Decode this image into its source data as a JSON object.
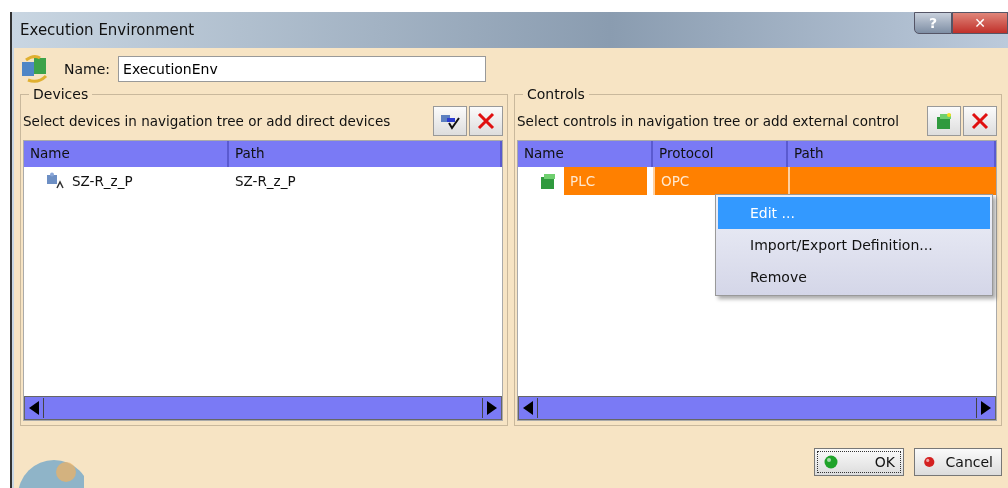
{
  "window": {
    "title": "Execution Environment",
    "help": "?",
    "close": "✕"
  },
  "name_field": {
    "label": "Name:",
    "value": "ExecutionEnv"
  },
  "devices": {
    "title": "Devices",
    "hint": "Select devices in navigation tree or add direct devices",
    "columns": [
      "Name",
      "Path"
    ],
    "rows": [
      {
        "name": "SZ-R_z_P",
        "path": "SZ-R_z_P",
        "selected": false
      }
    ]
  },
  "controls": {
    "title": "Controls",
    "hint": "Select controls in navigation tree or add external control",
    "columns": [
      "Name",
      "Protocol",
      "Path"
    ],
    "rows": [
      {
        "name": "PLC",
        "protocol": "OPC",
        "selected": true
      }
    ]
  },
  "context_menu": [
    {
      "label": "Edit ...",
      "selected": true
    },
    {
      "label": "Import/Export Definition...",
      "selected": false
    },
    {
      "label": "Remove",
      "selected": false
    }
  ],
  "buttons": [
    {
      "label": "OK",
      "kind": "ok"
    },
    {
      "label": "Cancel",
      "kind": "cancel"
    }
  ]
}
